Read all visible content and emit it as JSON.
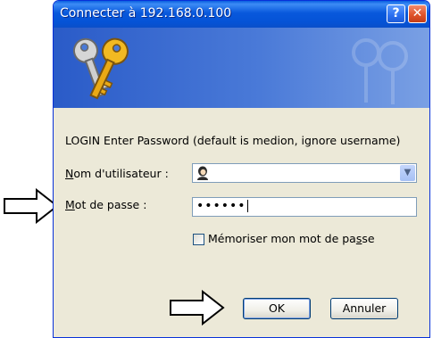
{
  "window": {
    "title": "Connecter à 192.168.0.100",
    "help_glyph": "?",
    "close_glyph": "✕"
  },
  "dialog": {
    "info": "LOGIN Enter Password (default is medion, ignore username)",
    "username_label_u": "N",
    "username_label_rest": "om d'utilisateur :",
    "password_label_u": "M",
    "password_label_rest": "ot de passe :",
    "password_value": "••••••",
    "remember_label_pre": "Mémoriser mon mot de pa",
    "remember_label_u": "s",
    "remember_label_post": "se",
    "remember_checked": false,
    "ok_label": "OK",
    "cancel_label": "Annuler"
  },
  "annotations": {
    "arrow_icons": [
      "right-arrow-icon-password",
      "right-arrow-icon-ok"
    ]
  },
  "colors": {
    "titlebar": "#0553d6",
    "dialog_bg": "#ece9d8",
    "field_border": "#7f9db9",
    "close_button": "#e0542b"
  }
}
